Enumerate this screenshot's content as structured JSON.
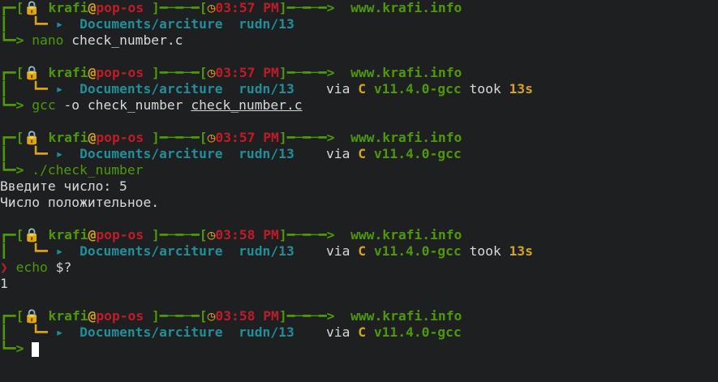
{
  "prompt": {
    "user": "krafi",
    "at": "@",
    "host": "pop-os",
    "site": "www.krafi.info",
    "path": "Documents/arciture",
    "branch": "rudn/13",
    "via": "via",
    "lang": "C",
    "version": "v11.4.0-gcc",
    "took": "took",
    "lock_icon": "lock-icon",
    "clock_icon": "clock-icon",
    "dir_icon": "folder-icon",
    "colors": {
      "frame": "#4e9a06",
      "time": "#c01c28",
      "path": "#1f8f99",
      "accent": "#d8a31a"
    }
  },
  "blocks": [
    {
      "time": "03:57 PM",
      "show_via": false,
      "duration": "",
      "command": "nano",
      "args": "check_number.c",
      "args_underlined": "",
      "output": []
    },
    {
      "time": "03:57 PM",
      "show_via": true,
      "duration": "13s",
      "command": "gcc",
      "args": "-o check_number",
      "args_underlined": "check_number.c",
      "output": []
    },
    {
      "time": "03:57 PM",
      "show_via": true,
      "duration": "",
      "command": "./check_number",
      "args": "",
      "args_underlined": "",
      "output": [
        "Введите число: 5",
        "Число положительное."
      ]
    },
    {
      "time": "03:58 PM",
      "show_via": true,
      "duration": "13s",
      "command": "echo",
      "args": "$?",
      "args_underlined": "",
      "error_prompt": true,
      "output": [
        "1"
      ]
    },
    {
      "time": "03:58 PM",
      "show_via": true,
      "duration": "",
      "command": "",
      "args": "",
      "args_underlined": "",
      "active": true,
      "output": []
    }
  ]
}
